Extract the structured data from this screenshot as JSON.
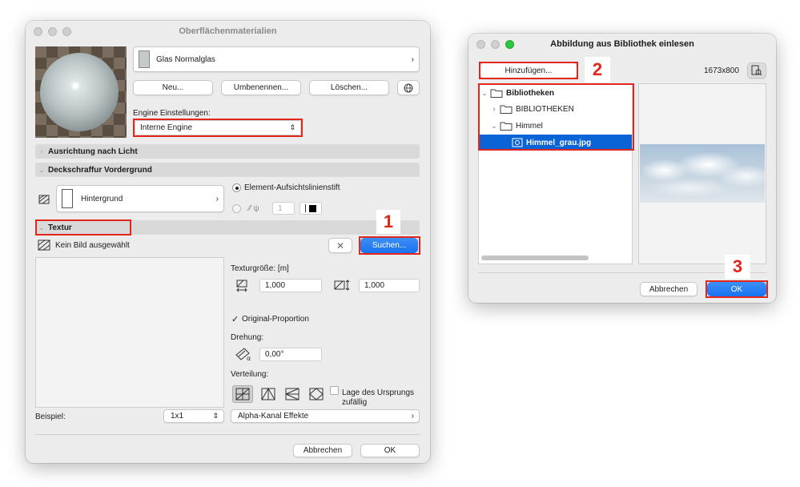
{
  "main_dialog": {
    "title": "Oberflächenmaterialien",
    "material_name": "Glas Normalglas",
    "buttons": {
      "new": "Neu...",
      "rename": "Umbenennen...",
      "delete": "Löschen..."
    },
    "engine_label": "Engine Einstellungen:",
    "engine_value": "Interne Engine",
    "sections": {
      "light": "Ausrichtung nach Licht",
      "hatch": "Deckschraffur Vordergrund",
      "texture": "Textur"
    },
    "hatch_name": "Hintergrund",
    "element_pen_label": "Element-Aufsichtslinienstift",
    "pen_value": "1",
    "no_image_label": "Kein Bild ausgewählt",
    "search_button": "Suchen...",
    "texture_size_label": "Texturgröße: [m]",
    "width_value": "1,000",
    "height_value": "1,000",
    "original_proportion_label": "Original-Proportion",
    "rotation_label": "Drehung:",
    "rotation_value": "0,00°",
    "distribution_label": "Verteilung:",
    "random_origin_label_1": "Lage des Ursprungs",
    "random_origin_label_2": "zufällig",
    "example_label": "Beispiel:",
    "example_value": "1x1",
    "alpha_label": "Alpha-Kanal Effekte",
    "cancel": "Abbrechen",
    "ok": "OK"
  },
  "library_dialog": {
    "title": "Abbildung aus Bibliothek einlesen",
    "add_button": "Hinzufügen...",
    "dimensions": "1673x800",
    "tree": [
      {
        "label": "Bibliotheken"
      },
      {
        "label": "BIBLIOTHEKEN"
      },
      {
        "label": "Himmel"
      },
      {
        "label": "Himmel_grau.jpg"
      }
    ],
    "cancel": "Abbrechen",
    "ok": "OK"
  },
  "annotations": {
    "step1": "1",
    "step2": "2",
    "step3": "3"
  },
  "colors": {
    "highlight_red": "#e3261b",
    "accent_blue": "#1a72ef",
    "selection_blue": "#0a64d6"
  }
}
